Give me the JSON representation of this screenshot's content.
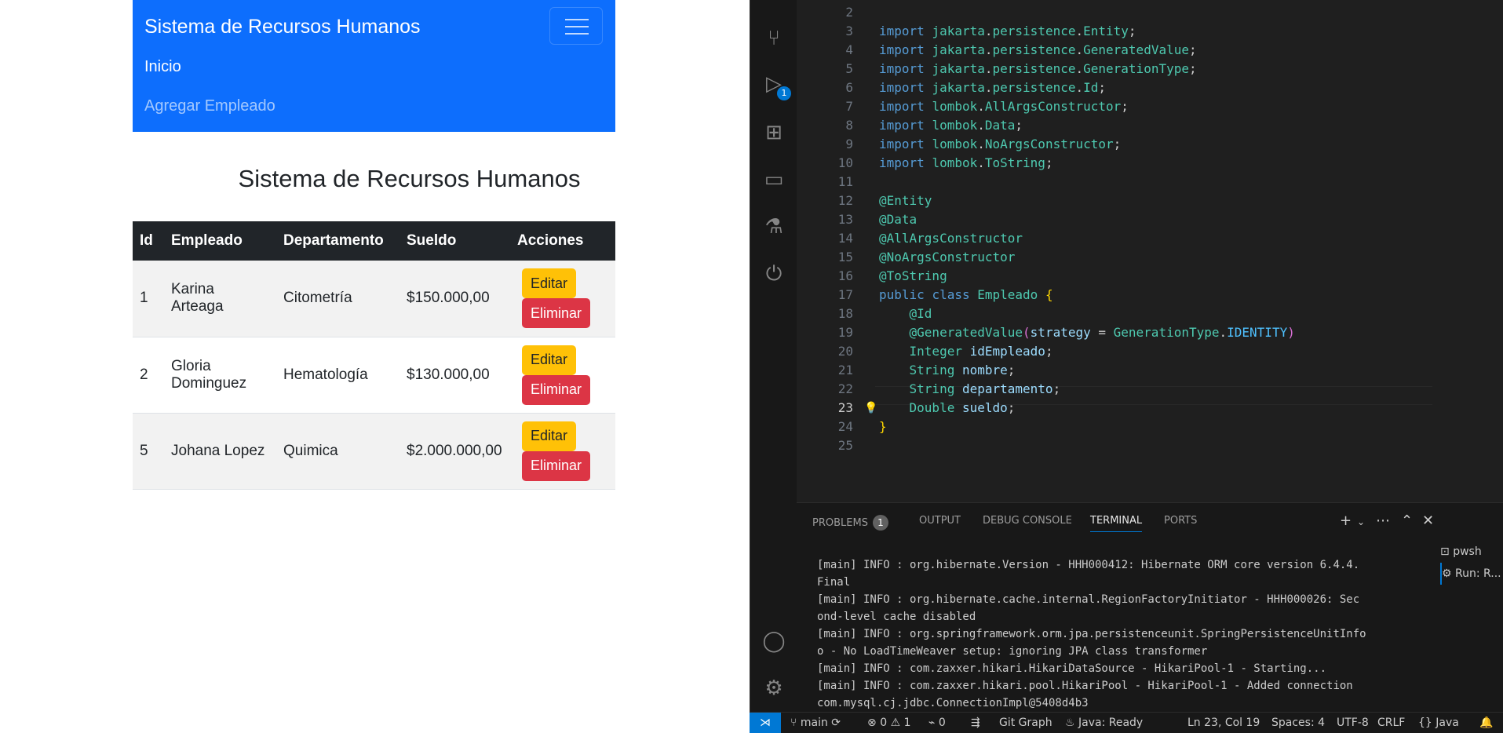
{
  "app": {
    "brand": "Sistema de Recursos Humanos",
    "nav": {
      "inicio": "Inicio",
      "agregar": "Agregar Empleado"
    },
    "page_title": "Sistema de Recursos Humanos",
    "table": {
      "headers": [
        "Id",
        "Empleado",
        "Departamento",
        "Sueldo",
        "Acciones"
      ],
      "rows": [
        {
          "id": "1",
          "empleado": "Karina Arteaga",
          "departamento": "Citometría",
          "sueldo": "$150.000,00"
        },
        {
          "id": "2",
          "empleado": "Gloria Dominguez",
          "departamento": "Hematología",
          "sueldo": "$130.000,00"
        },
        {
          "id": "5",
          "empleado": "Johana Lopez",
          "departamento": "Quimica",
          "sueldo": "$2.000.000,00"
        }
      ],
      "edit_label": "Editar",
      "delete_label": "Eliminar"
    },
    "colors": {
      "navbar": "#0d6efd",
      "edit": "#ffc107",
      "delete": "#dc3545",
      "table_head": "#212529"
    }
  },
  "editor": {
    "active_line": "23",
    "lines": [
      {
        "n": "2"
      },
      {
        "n": "3",
        "import": "jakarta",
        "pkg": "persistence",
        "cls": "Entity"
      },
      {
        "n": "4",
        "import": "jakarta",
        "pkg": "persistence",
        "cls": "GeneratedValue"
      },
      {
        "n": "5",
        "import": "jakarta",
        "pkg": "persistence",
        "cls": "GenerationType"
      },
      {
        "n": "6",
        "import": "jakarta",
        "pkg": "persistence",
        "cls": "Id"
      },
      {
        "n": "7",
        "import": "lombok",
        "cls": "AllArgsConstructor"
      },
      {
        "n": "8",
        "import": "lombok",
        "cls": "Data"
      },
      {
        "n": "9",
        "import": "lombok",
        "cls": "NoArgsConstructor"
      },
      {
        "n": "10",
        "import": "lombok",
        "cls": "ToString"
      },
      {
        "n": "11"
      },
      {
        "n": "12",
        "annotation": "Entity"
      },
      {
        "n": "13",
        "annotation": "Data"
      },
      {
        "n": "14",
        "annotation": "AllArgsConstructor"
      },
      {
        "n": "15",
        "annotation": "NoArgsConstructor"
      },
      {
        "n": "16",
        "annotation": "ToString"
      },
      {
        "n": "17",
        "classdecl": "Empleado"
      },
      {
        "n": "18",
        "indent": true,
        "annotation": "Id"
      },
      {
        "n": "19",
        "generated": true
      },
      {
        "n": "20",
        "field_type": "Integer",
        "field_name": "idEmpleado"
      },
      {
        "n": "21",
        "field_type": "String",
        "field_name": "nombre"
      },
      {
        "n": "22",
        "field_type": "String",
        "field_name": "departamento"
      },
      {
        "n": "23",
        "field_type": "Double",
        "field_name": "sueldo",
        "bulb": true
      },
      {
        "n": "24",
        "close": true
      },
      {
        "n": "25"
      }
    ],
    "keywords": {
      "import": "import",
      "public": "public",
      "class": "class",
      "strategy": "strategy",
      "gentype": "GenerationType",
      "identity": "IDENTITY",
      "genvalue": "GeneratedValue"
    }
  },
  "panel": {
    "tabs": [
      "PROBLEMS",
      "OUTPUT",
      "DEBUG CONSOLE",
      "TERMINAL",
      "PORTS"
    ],
    "problems_count": "1",
    "active_tab": "TERMINAL",
    "terminal_lines": [
      "[main] INFO : org.hibernate.Version - HHH000412: Hibernate ORM core version 6.4.4.",
      "Final",
      "[main] INFO : org.hibernate.cache.internal.RegionFactoryInitiator - HHH000026: Sec",
      "ond-level cache disabled",
      "[main] INFO : org.springframework.orm.jpa.persistenceunit.SpringPersistenceUnitInfo",
      "o - No LoadTimeWeaver setup: ignoring JPA class transformer",
      "[main] INFO : com.zaxxer.hikari.HikariDataSource - HikariPool-1 - Starting...",
      "[main] INFO : com.zaxxer.hikari.pool.HikariPool - HikariPool-1 - Added connection",
      "com.mysql.cj.jdbc.ConnectionImpl@5408d4b3"
    ],
    "terminals": [
      "pwsh",
      "Run: R..."
    ]
  },
  "statusbar": {
    "branch": "main",
    "errors": "0",
    "warnings": "1",
    "ports": "0",
    "git_graph": "Git Graph",
    "java": "Java: Ready",
    "position": "Ln 23, Col 19",
    "spaces": "Spaces: 4",
    "encoding": "UTF-8",
    "eol": "CRLF",
    "language": "Java"
  },
  "activity_badge": "1"
}
